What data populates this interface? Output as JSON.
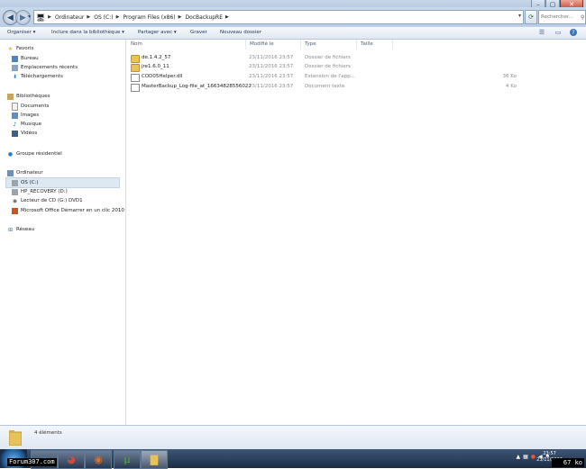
{
  "window": {
    "controls": {
      "minimize": "–",
      "maximize": "▢",
      "close": "✕"
    }
  },
  "addressbar": {
    "breadcrumb": [
      "Ordinateur",
      "OS (C:)",
      "Program Files (x86)",
      "DocBackupRE"
    ],
    "search_placeholder": "Rechercher..."
  },
  "toolbar": {
    "items": [
      "Organiser ▾",
      "Inclure dans la bibliothèque ▾",
      "Partager avec ▾",
      "Graver",
      "Nouveau dossier"
    ]
  },
  "navpane": {
    "items": [
      {
        "label": "Favoris",
        "icon": "star-icon",
        "level": 0
      },
      {
        "label": "Bureau",
        "icon": "desktop-icon",
        "level": 1
      },
      {
        "label": "Emplacements récents",
        "icon": "recent-places-icon",
        "level": 1
      },
      {
        "label": "Téléchargements",
        "icon": "downloads-icon",
        "level": 1
      },
      {
        "label": "Bibliothèques",
        "icon": "libraries-icon",
        "level": 0
      },
      {
        "label": "Documents",
        "icon": "documents-icon",
        "level": 1
      },
      {
        "label": "Images",
        "icon": "images-icon",
        "level": 1
      },
      {
        "label": "Musique",
        "icon": "music-icon",
        "level": 1
      },
      {
        "label": "Vidéos",
        "icon": "videos-icon",
        "level": 1
      },
      {
        "label": "Groupe résidentiel",
        "icon": "homegroup-icon",
        "level": 0
      },
      {
        "label": "Ordinateur",
        "icon": "computer-icon",
        "level": 0
      },
      {
        "label": "OS (C:)",
        "icon": "drive-icon",
        "level": 1,
        "selected": true
      },
      {
        "label": "HP_RECOVERY (D:)",
        "icon": "drive-icon",
        "level": 1
      },
      {
        "label": "Lecteur de CD (G:) DVD1",
        "icon": "cd-drive-icon",
        "level": 1
      },
      {
        "label": "Microsoft Office Démarrer en un clic 2010",
        "icon": "office-drive-icon",
        "level": 1
      },
      {
        "label": "Réseau",
        "icon": "network-icon",
        "level": 0
      }
    ]
  },
  "columns": {
    "name": "Nom",
    "date": "Modifié le",
    "type": "Type",
    "size": "Taille"
  },
  "files": [
    {
      "name": "de.1.4.2_57",
      "date": "23/11/2016 23:57",
      "type": "Dossier de fichiers",
      "size": "",
      "kind": "folder"
    },
    {
      "name": "jre1.6.0_11",
      "date": "23/11/2016 23:57",
      "type": "Dossier de fichiers",
      "size": "",
      "kind": "folder"
    },
    {
      "name": "COD05Helper.dll",
      "date": "23/11/2016 23:57",
      "type": "Extension de l'app...",
      "size": "36 Ko",
      "kind": "file"
    },
    {
      "name": "MasterBackup_Log-file_at_16634828556022",
      "date": "23/11/2016 23:57",
      "type": "Document texte",
      "size": "4 Ko",
      "kind": "file"
    }
  ],
  "details": {
    "count": "4 éléments"
  },
  "taskbar": {
    "clock_time": "23:57",
    "clock_date": "23/11/2016"
  },
  "overlays": {
    "watermark": "Forum307.com",
    "netspeed": "67 ko"
  },
  "colors": {
    "folder": "#e7c35a",
    "selection": "#dde8f3",
    "taskbar": "#1c2d44"
  }
}
